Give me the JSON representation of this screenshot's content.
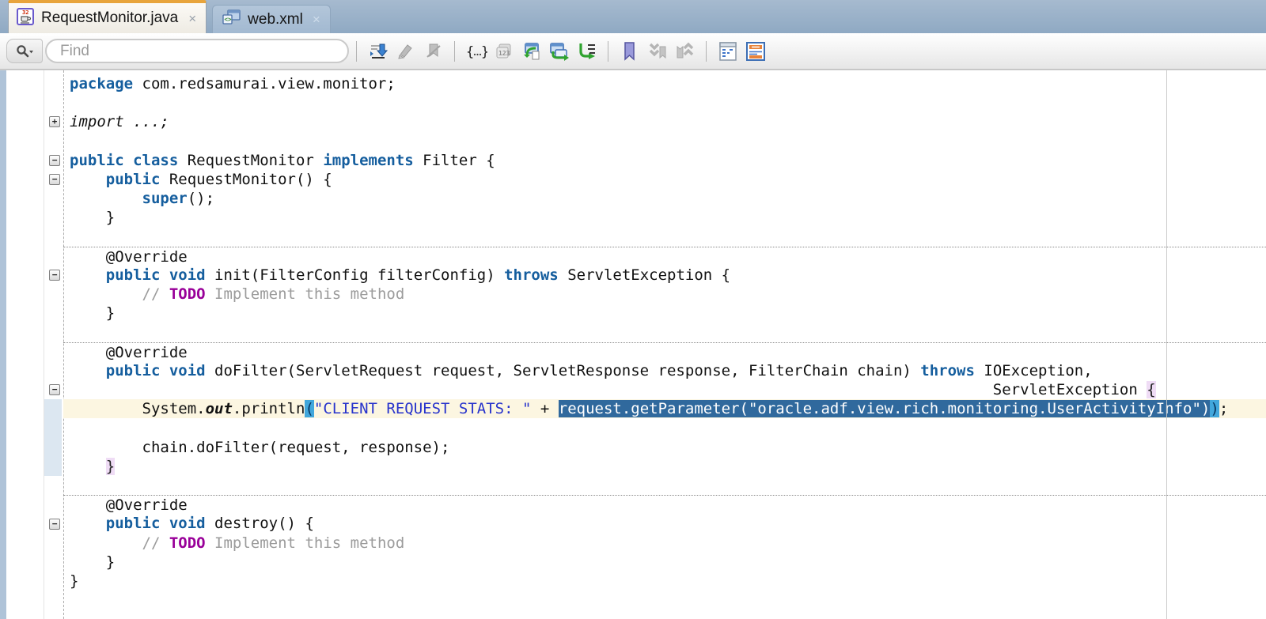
{
  "tabs": [
    {
      "label": "RequestMonitor.java",
      "icon": "java-file-icon",
      "active": true,
      "close_glyph": "×"
    },
    {
      "label": "web.xml",
      "icon": "xml-file-icon",
      "active": false,
      "close_glyph": "×"
    }
  ],
  "toolbar": {
    "find_placeholder": "Find",
    "find_value": "",
    "icons": [
      {
        "name": "find-options-icon",
        "disabled": false
      },
      {
        "name": "go-to-last-edit-icon",
        "disabled": false
      },
      {
        "name": "highlight-icon",
        "disabled": true
      },
      {
        "name": "clear-highlights-icon",
        "disabled": true
      },
      {
        "name": "surround-with-icon",
        "disabled": false
      },
      {
        "name": "toggle-line-numbers-icon",
        "disabled": true
      },
      {
        "name": "navigate-back-icon",
        "disabled": false
      },
      {
        "name": "navigate-forward-icon",
        "disabled": false
      },
      {
        "name": "go-to-line-icon",
        "disabled": false
      },
      {
        "name": "toggle-bookmark-icon",
        "disabled": false
      },
      {
        "name": "next-bookmark-icon",
        "disabled": true
      },
      {
        "name": "previous-bookmark-icon",
        "disabled": true
      },
      {
        "name": "compare-with-icon",
        "disabled": false
      },
      {
        "name": "split-document-icon",
        "disabled": false
      }
    ]
  },
  "editor": {
    "colors": {
      "keyword": "#155E9E",
      "string": "#2733CC",
      "comment": "#9B9B9B",
      "todo": "#990099",
      "selection_bg": "#30699D",
      "current_line_bg": "#FCF6E1",
      "paren_match_bg": "#41A7DC",
      "brace_match_bg": "#EFDCF5",
      "active_tab_accent": "#E8A43C",
      "tabbar_bg": "#8FA9C3"
    },
    "current_line": 17,
    "separators": [
      9,
      14,
      22
    ],
    "folds": [
      {
        "line": 2,
        "type": "plus"
      },
      {
        "line": 4,
        "type": "minus"
      },
      {
        "line": 5,
        "type": "minus"
      },
      {
        "line": 10,
        "type": "minus"
      },
      {
        "line": 16,
        "type": "minus"
      },
      {
        "line": 23,
        "type": "minus"
      }
    ],
    "fold_highlight": {
      "from": 17,
      "to": 20
    },
    "lines": [
      [
        {
          "t": "package",
          "s": "k"
        },
        {
          "t": " com.redsamurai.view.monitor;"
        }
      ],
      [],
      [
        {
          "t": "import ...;",
          "s": "it"
        }
      ],
      [],
      [
        {
          "t": "public class",
          "s": "k"
        },
        {
          "t": " RequestMonitor "
        },
        {
          "t": "implements",
          "s": "k"
        },
        {
          "t": " Filter {"
        }
      ],
      [
        {
          "t": "    "
        },
        {
          "t": "public",
          "s": "k"
        },
        {
          "t": " RequestMonitor() {"
        }
      ],
      [
        {
          "t": "        "
        },
        {
          "t": "super",
          "s": "k"
        },
        {
          "t": "();"
        }
      ],
      [
        {
          "t": "    }"
        }
      ],
      [],
      [
        {
          "t": "    @Override"
        }
      ],
      [
        {
          "t": "    "
        },
        {
          "t": "public void",
          "s": "k"
        },
        {
          "t": " init(FilterConfig filterConfig) "
        },
        {
          "t": "throws",
          "s": "k"
        },
        {
          "t": " ServletException {"
        }
      ],
      [
        {
          "t": "        "
        },
        {
          "t": "// ",
          "s": "cm"
        },
        {
          "t": "TODO",
          "s": "td"
        },
        {
          "t": " Implement this method",
          "s": "cm"
        }
      ],
      [
        {
          "t": "    }"
        }
      ],
      [],
      [
        {
          "t": "    @Override"
        }
      ],
      [
        {
          "t": "    "
        },
        {
          "t": "public void",
          "s": "k"
        },
        {
          "t": " doFilter(ServletRequest request, ServletResponse response, FilterChain chain) "
        },
        {
          "t": "throws",
          "s": "k"
        },
        {
          "t": " IOException,"
        }
      ],
      [
        {
          "t": "                                                                                                      "
        },
        {
          "t": "ServletException "
        },
        {
          "t": "{",
          "s": "bh"
        }
      ],
      [
        {
          "t": "        System."
        },
        {
          "t": "out",
          "s": "bi"
        },
        {
          "t": ".println"
        },
        {
          "t": "(",
          "s": "ph"
        },
        {
          "t": "\"CLIENT REQUEST STATS: \"",
          "s": "str"
        },
        {
          "t": " + "
        },
        {
          "t": "request.getParameter(\"oracle.adf.view.rich.monitoring.UserActivityInfo\")",
          "s": "sel"
        },
        {
          "t": ")",
          "s": "ph"
        },
        {
          "t": ";"
        }
      ],
      [],
      [
        {
          "t": "        chain.doFilter(request, response);"
        }
      ],
      [
        {
          "t": "    "
        },
        {
          "t": "}",
          "s": "bh"
        }
      ],
      [],
      [
        {
          "t": "    @Override"
        }
      ],
      [
        {
          "t": "    "
        },
        {
          "t": "public void",
          "s": "k"
        },
        {
          "t": " destroy() {"
        }
      ],
      [
        {
          "t": "        "
        },
        {
          "t": "// ",
          "s": "cm"
        },
        {
          "t": "TODO",
          "s": "td"
        },
        {
          "t": " Implement this method",
          "s": "cm"
        }
      ],
      [
        {
          "t": "    }"
        }
      ],
      [
        {
          "t": "}"
        }
      ],
      []
    ]
  }
}
